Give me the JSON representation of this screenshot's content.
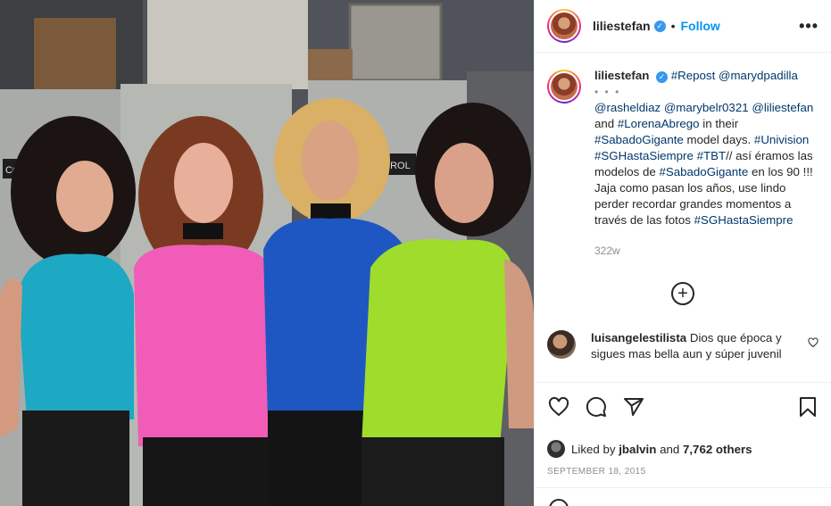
{
  "post": {
    "username": "liliestefan",
    "verified_mark": "✓",
    "dot": "•",
    "follow_label": "Follow",
    "more_label": "•••"
  },
  "caption": {
    "username": "liliestefan",
    "repost": "#Repost",
    "repost_user": "@marydpadilla",
    "dots": "• • •",
    "tag1": "@rasheldiaz",
    "tag2": "@marybelr0321",
    "tag3": "@liliestefan",
    "and1": "and",
    "tag4": "#LorenaAbrego",
    "in_their": "in their",
    "tag5": "#SabadoGigante",
    "model_days": "model days.",
    "tag6": "#Univision",
    "tag7": "#SGHastaSiempre",
    "tag8": "#TBT",
    "text1": "// así éramos las modelos de",
    "tag9": "#SabadoGigante",
    "text2": "en los 90 !!! Jaja como pasan los años, use lindo perder recordar grandes momentos a través de las fotos",
    "tag10": "#SGHastaSiempre",
    "time_ago": "322w"
  },
  "load_more_label": "+",
  "comment": {
    "username": "luisangelestilista",
    "text": "Dios que época y sigues mas bella aun y súper juvenil"
  },
  "likes": {
    "prefix": "Liked by",
    "user": "jbalvin",
    "and": "and",
    "count": "7,762 others"
  },
  "date": "SEPTEMBER 18, 2015",
  "photo": {
    "sign_left": "COST",
    "sign_right": "STIROL"
  },
  "icons": [
    "heart-icon",
    "comment-icon",
    "share-icon",
    "bookmark-icon",
    "add-comment-icon",
    "like-comment-icon",
    "emoji-icon"
  ],
  "colors": {
    "accent": "#0095f6",
    "link": "#00376b",
    "verified": "#3897f0",
    "muted": "#8e8e8e"
  }
}
